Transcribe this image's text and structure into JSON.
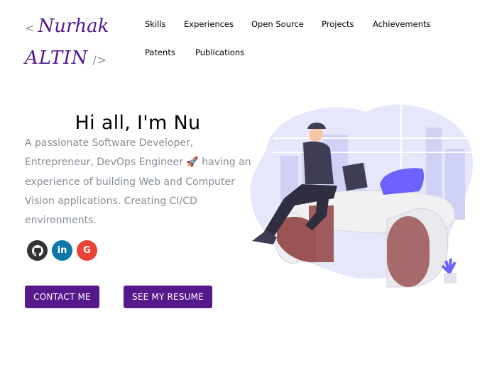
{
  "logo": {
    "open_bracket": "<",
    "first_name": "Nurhak",
    "last_name": "ALTIN",
    "close_bracket": "/>"
  },
  "nav": {
    "items": [
      "Skills",
      "Experiences",
      "Open Source",
      "Projects",
      "Achievements",
      "Patents",
      "Publications"
    ]
  },
  "hero": {
    "greeting": "Hi all, I'm Nu",
    "bio": "A passionate Software Developer, Entrepreneur, DevOps Engineer 🚀 having an experience of building Web and Computer Vision applications. Creating CI/CD environments."
  },
  "socials": [
    {
      "name": "github-icon",
      "glyph": "⌥"
    },
    {
      "name": "linkedin-icon",
      "glyph": "in"
    },
    {
      "name": "google-icon",
      "glyph": "G"
    }
  ],
  "buttons": {
    "contact": "CONTACT ME",
    "resume": "SEE MY RESUME"
  },
  "colors": {
    "accent": "#55198b",
    "text_secondary": "#868e96",
    "blob": "#e8e9fb"
  }
}
